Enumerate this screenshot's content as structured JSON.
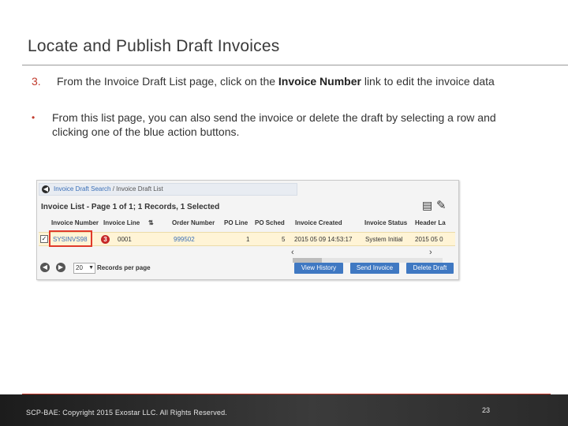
{
  "slide": {
    "title": "Locate and Publish Draft Invoices",
    "bullets": [
      {
        "marker": "3.",
        "text_before": "From the Invoice Draft List page, click on the ",
        "bold": "Invoice Number",
        "text_after": " link to edit the invoice data"
      },
      {
        "marker": "•",
        "text": "From this list page, you can also send the invoice or delete the draft by selecting a row and clicking one of the blue action buttons."
      }
    ]
  },
  "screenshot": {
    "breadcrumb": {
      "search": "Invoice Draft Search",
      "separator": " / ",
      "current": "Invoice Draft List"
    },
    "list_title": "Invoice List - Page 1 of 1; 1 Records, 1 Selected",
    "columns": [
      "Invoice Number",
      "Invoice Line",
      "Order Number",
      "PO Line",
      "PO Sched",
      "Invoice Created",
      "Invoice Status",
      "Header La"
    ],
    "row": {
      "checked": "✓",
      "invoice_number": "SYSINVS98",
      "invoice_line": "0001",
      "order_number": "999502",
      "po_line": "1",
      "po_sched": "5",
      "invoice_created": "2015 05 09 14:53:17",
      "invoice_status": "System Initial",
      "header_la": "2015 05 0"
    },
    "step_badge": "3",
    "pager": {
      "page_size": "20",
      "label": "Records per page"
    },
    "actions": {
      "view_history": "View History",
      "send_invoice": "Send Invoice",
      "delete_draft": "Delete Draft"
    }
  },
  "footer": {
    "copyright": "SCP-BAE:  Copyright 2015 Exostar LLC. All Rights Reserved.",
    "page_number": "23"
  },
  "colors": {
    "accent_red": "#c0392b",
    "link_blue": "#3a6fb7",
    "button_blue": "#3f78c2",
    "selected_row": "#fff4d6"
  }
}
